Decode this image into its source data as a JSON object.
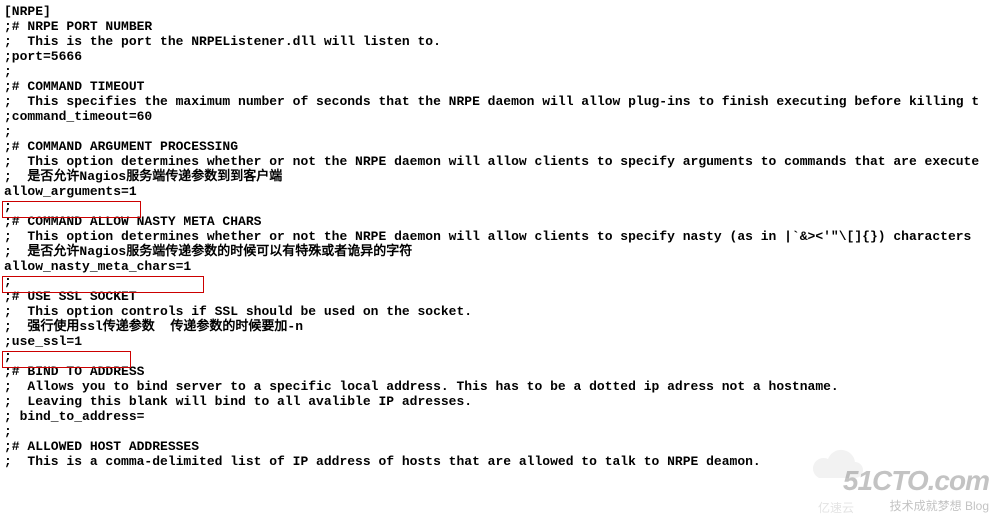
{
  "config": {
    "l0": "[NRPE]",
    "l1": ";# NRPE PORT NUMBER",
    "l2": ";  This is the port the NRPEListener.dll will listen to.",
    "l3": ";port=5666",
    "l4": ";",
    "l5": ";# COMMAND TIMEOUT",
    "l6": ";  This specifies the maximum number of seconds that the NRPE daemon will allow plug-ins to finish executing before killing t",
    "l7": ";command_timeout=60",
    "l8": ";",
    "l9": ";# COMMAND ARGUMENT PROCESSING",
    "l10": ";  This option determines whether or not the NRPE daemon will allow clients to specify arguments to commands that are execute",
    "l11": ";  是否允许Nagios服务端传递参数到到客户端",
    "l12": "allow_arguments=1",
    "l13": ";",
    "l14": ";# COMMAND ALLOW NASTY META CHARS",
    "l15": ";  This option determines whether or not the NRPE daemon will allow clients to specify nasty (as in |`&><'\"\\[]{}) characters ",
    "l16": ";  是否允许Nagios服务端传递参数的时候可以有特殊或者诡异的字符",
    "l17": "allow_nasty_meta_chars=1",
    "l18": ";",
    "l19": ";# USE SSL SOCKET",
    "l20": ";  This option controls if SSL should be used on the socket.",
    "l21": ";  强行使用ssl传递参数  传递参数的时候要加-n",
    "l22": ";use_ssl=1",
    "l23": ";",
    "l24": ";# BIND TO ADDRESS",
    "l25": ";  Allows you to bind server to a specific local address. This has to be a dotted ip adress not a hostname.",
    "l26": ";  Leaving this blank will bind to all avalible IP adresses.",
    "l27": "; bind_to_address=",
    "l28": ";",
    "l29": ";# ALLOWED HOST ADDRESSES",
    "l30": ";  This is a comma-delimited list of IP address of hosts that are allowed to talk to NRPE deamon."
  },
  "watermark": {
    "main": "51CTO.com",
    "sub": "技术成就梦想   Blog",
    "cloud": "亿速云"
  }
}
